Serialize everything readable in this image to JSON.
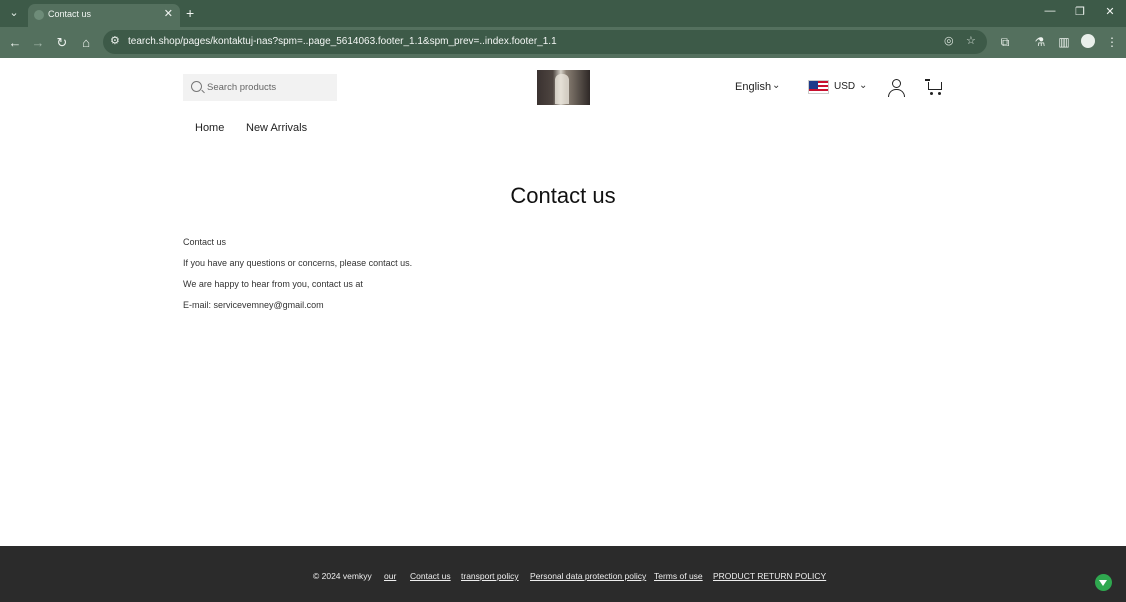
{
  "browser": {
    "tab_title": "Contact us",
    "url": "tearch.shop/pages/kontaktuj-nas?spm=..page_5614063.footer_1.1&spm_prev=..index.footer_1.1"
  },
  "header": {
    "search_placeholder": "Search products",
    "language": "English",
    "currency": "USD"
  },
  "nav": {
    "items": [
      {
        "label": "Home"
      },
      {
        "label": "New Arrivals"
      }
    ]
  },
  "main": {
    "title": "Contact us",
    "lines": [
      "Contact us",
      "If you have any questions or concerns, please contact us.",
      "We are happy to hear from you, contact us at",
      "E-mail: servicevemney@gmail.com"
    ]
  },
  "footer": {
    "copyright": "© 2024 vemkyy",
    "links": [
      {
        "label": "our"
      },
      {
        "label": "Contact us"
      },
      {
        "label": "transport policy"
      },
      {
        "label": "Personal data protection policy"
      },
      {
        "label": "Terms of use"
      },
      {
        "label": "PRODUCT RETURN POLICY"
      }
    ]
  }
}
